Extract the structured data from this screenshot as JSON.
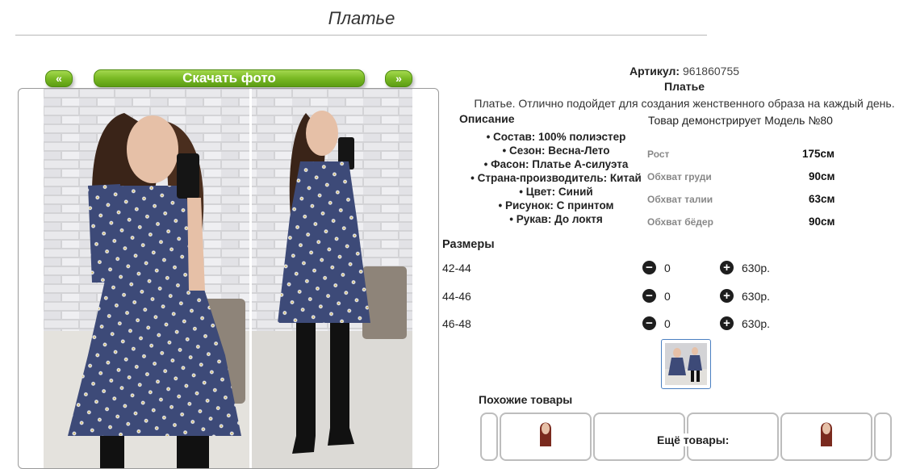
{
  "page": {
    "title": "Платье"
  },
  "gallery": {
    "prev_label": "«",
    "next_label": "»",
    "download_label": "Скачать фото"
  },
  "product": {
    "artikul_label": "Артикул:",
    "artikul_value": "961860755",
    "name": "Платье",
    "description": "Платье. Отлично подойдет для создания женственного образа на каждый день."
  },
  "features": {
    "heading": "Описание",
    "items": [
      "• Состав: 100% полиэстер",
      "• Сезон: Весна-Лето",
      "• Фасон: Платье А-силуэта",
      "• Страна-производитель: Китай",
      "• Цвет: Синий",
      "• Рисунок: С принтом",
      "• Рукав: До локтя"
    ]
  },
  "model": {
    "heading": "Товар демонстрирует Модель №80",
    "measurements": [
      {
        "label": "Рост",
        "value": "175см"
      },
      {
        "label": "Обхват груди",
        "value": "90см"
      },
      {
        "label": "Обхват талии",
        "value": "63см"
      },
      {
        "label": "Обхват бёдер",
        "value": "90см"
      }
    ]
  },
  "sizes": {
    "heading": "Размеры",
    "rows": [
      {
        "size": "42-44",
        "qty": "0",
        "price": "630р."
      },
      {
        "size": "44-46",
        "qty": "0",
        "price": "630р."
      },
      {
        "size": "46-48",
        "qty": "0",
        "price": "630р."
      }
    ],
    "minus_glyph": "−",
    "plus_glyph": "+"
  },
  "similar": {
    "heading": "Похожие товары"
  },
  "more": {
    "heading": "Ещё товары:"
  },
  "colors": {
    "button_green": "#79b924",
    "dress_navy": "#3d4a78",
    "brick_wall": "#c9c9cc",
    "thumb_border": "#4a7fc1"
  }
}
